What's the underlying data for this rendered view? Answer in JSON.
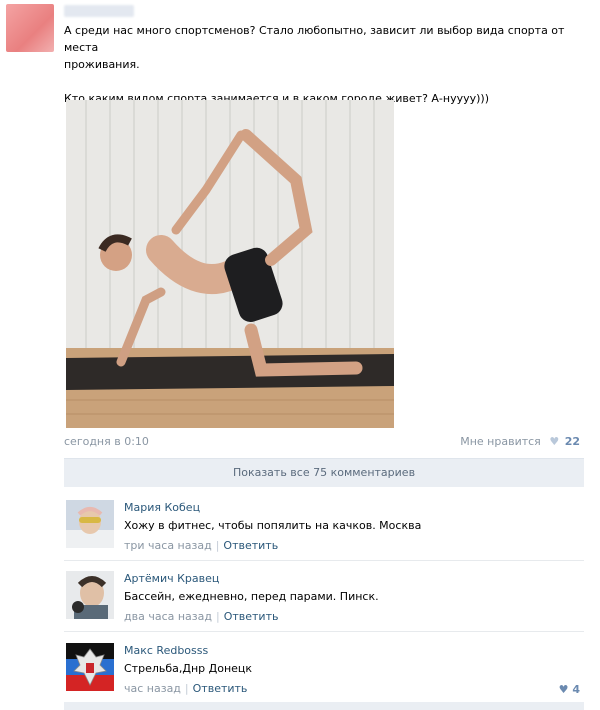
{
  "post": {
    "line1": "А среди нас много спортсменов? Стало любопытно, зависит ли выбор вида спорта от места",
    "line2": "проживания.",
    "line3": "Кто каким видом спорта занимается и в каком городе живет? А-нуууу)))",
    "time": "сегодня в 0:10",
    "like_label": "Мне нравится",
    "like_count": "22"
  },
  "show_all": "Показать все 75 комментариев",
  "comments": [
    {
      "author": "Мария Кобец",
      "text": "Хожу в фитнес, чтобы попялить на качков. Москва",
      "time": "три часа назад",
      "reply": "Ответить"
    },
    {
      "author": "Артёмич Кравец",
      "text": "Бассейн, ежедневно, перед парами. Пинск.",
      "time": "два часа назад",
      "reply": "Ответить"
    },
    {
      "author": "Макс Redbosss",
      "text": "Стрельба,Днр Донецк",
      "time": "час назад",
      "reply": "Ответить",
      "likes": "4"
    }
  ],
  "colors": {
    "link": "#2b587a",
    "muted": "#8a96a3",
    "bar": "#eaeef3"
  }
}
